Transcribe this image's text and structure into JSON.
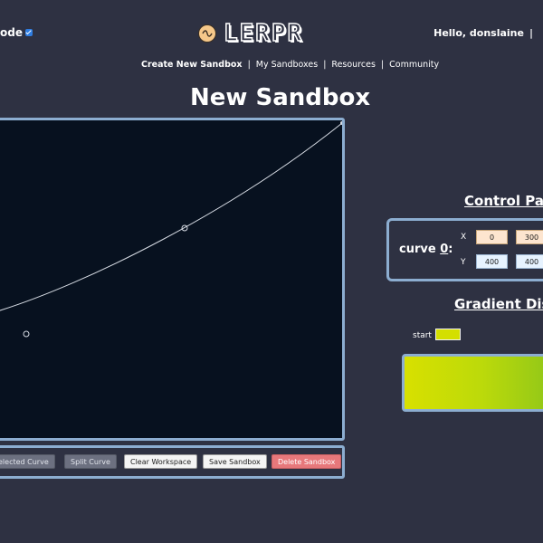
{
  "header": {
    "darkmode_label": "ode",
    "logo_text": "LERPR",
    "greeting": "Hello, donslaine",
    "greeting_sep": "|"
  },
  "nav": {
    "items": [
      "Create New Sandbox",
      "My Sandboxes",
      "Resources",
      "Community"
    ],
    "sep": "|"
  },
  "page": {
    "title": "New Sandbox"
  },
  "toolbar": {
    "delete_selected": "elected Curve",
    "split": "Split Curve",
    "clear": "Clear Workspace",
    "save": "Save Sandbox",
    "delete_sandbox": "Delete Sandbox"
  },
  "control_panel": {
    "heading": "Control Par",
    "curve_prefix": "curve ",
    "curve_index": "0",
    "curve_suffix": ":",
    "x_label": "X",
    "y_label": "Y",
    "x_values": [
      "0",
      "300"
    ],
    "y_values": [
      "400",
      "400"
    ]
  },
  "gradient": {
    "heading": "Gradient Dis",
    "start_label": "start",
    "start_color": "#d4df00",
    "colors": [
      "#d8e000",
      "#bcda0a",
      "#8dc51a"
    ]
  },
  "colors": {
    "background": "#2e3142",
    "canvas": "#07111f",
    "border": "#8cadd0",
    "danger": "#e7787b"
  }
}
